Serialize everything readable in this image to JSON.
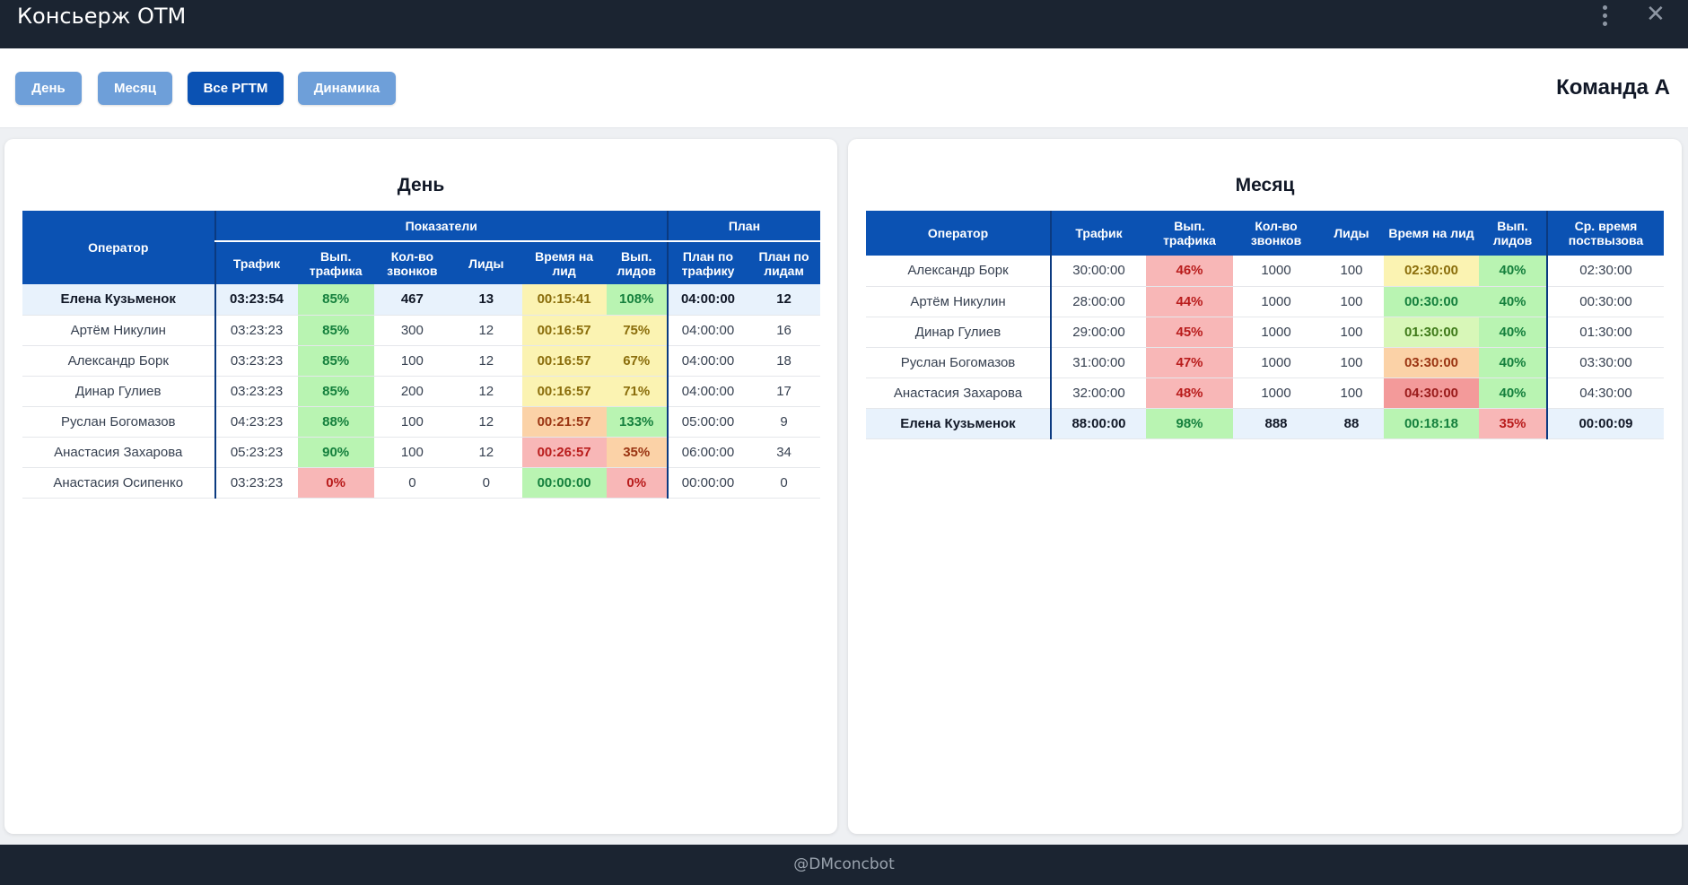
{
  "app": {
    "title": "Консьерж ОТМ"
  },
  "toolbar": {
    "buttons": [
      {
        "label": "День"
      },
      {
        "label": "Месяц"
      },
      {
        "label": "Все РГТМ"
      },
      {
        "label": "Динамика"
      }
    ],
    "team": "Команда А"
  },
  "day": {
    "title": "День",
    "headers": {
      "operator": "Оператор",
      "group_indicators": "Показатели",
      "group_plan": "План",
      "traffic": "Трафик",
      "traffic_pct": "Вып. трафика",
      "calls": "Кол-во звонков",
      "leads": "Лиды",
      "time_per_lead": "Время на лид",
      "leads_pct": "Вып. лидов",
      "plan_traffic": "План по трафику",
      "plan_leads": "План по лидам"
    },
    "rows": [
      [
        "Елена Кузьменок",
        "03:23:54",
        "85%",
        "467",
        "13",
        "00:15:41",
        "108%",
        "04:00:00",
        "12"
      ],
      [
        "Артём Никулин",
        "03:23:23",
        "85%",
        "300",
        "12",
        "00:16:57",
        "75%",
        "04:00:00",
        "16"
      ],
      [
        "Александр Борк",
        "03:23:23",
        "85%",
        "100",
        "12",
        "00:16:57",
        "67%",
        "04:00:00",
        "18"
      ],
      [
        "Динар Гулиев",
        "03:23:23",
        "85%",
        "200",
        "12",
        "00:16:57",
        "71%",
        "04:00:00",
        "17"
      ],
      [
        "Руслан Богомазов",
        "04:23:23",
        "88%",
        "100",
        "12",
        "00:21:57",
        "133%",
        "05:00:00",
        "9"
      ],
      [
        "Анастасия Захарова",
        "05:23:23",
        "90%",
        "100",
        "12",
        "00:26:57",
        "35%",
        "06:00:00",
        "34"
      ],
      [
        "Анастасия Осипенко",
        "03:23:23",
        "0%",
        "0",
        "0",
        "00:00:00",
        "0%",
        "00:00:00",
        "0"
      ]
    ],
    "cell_colors": [
      [
        "",
        "",
        "green",
        "",
        "",
        "yellow",
        "green",
        "",
        ""
      ],
      [
        "",
        "",
        "green",
        "",
        "",
        "yellow",
        "yellow",
        "",
        ""
      ],
      [
        "",
        "",
        "green",
        "",
        "",
        "yellow",
        "yellow",
        "",
        ""
      ],
      [
        "",
        "",
        "green",
        "",
        "",
        "yellow",
        "yellow",
        "",
        ""
      ],
      [
        "",
        "",
        "green",
        "",
        "",
        "orange",
        "green",
        "",
        ""
      ],
      [
        "",
        "",
        "green",
        "",
        "",
        "red",
        "orange",
        "",
        ""
      ],
      [
        "",
        "",
        "red",
        "",
        "",
        "green",
        "red",
        "",
        ""
      ]
    ],
    "highlight_row": 0
  },
  "month": {
    "title": "Месяц",
    "headers": {
      "operator": "Оператор",
      "traffic": "Трафик",
      "traffic_pct": "Вып. трафика",
      "calls": "Кол-во звонков",
      "leads": "Лиды",
      "time_per_lead": "Время на лид",
      "leads_pct": "Вып. лидов",
      "avg_recall": "Ср. время поствызова"
    },
    "rows": [
      [
        "Александр Борк",
        "30:00:00",
        "46%",
        "1000",
        "100",
        "02:30:00",
        "40%",
        "02:30:00"
      ],
      [
        "Артём Никулин",
        "28:00:00",
        "44%",
        "1000",
        "100",
        "00:30:00",
        "40%",
        "00:30:00"
      ],
      [
        "Динар Гулиев",
        "29:00:00",
        "45%",
        "1000",
        "100",
        "01:30:00",
        "40%",
        "01:30:00"
      ],
      [
        "Руслан Богомазов",
        "31:00:00",
        "47%",
        "1000",
        "100",
        "03:30:00",
        "40%",
        "03:30:00"
      ],
      [
        "Анастасия Захарова",
        "32:00:00",
        "48%",
        "1000",
        "100",
        "04:30:00",
        "40%",
        "04:30:00"
      ],
      [
        "Елена Кузьменок",
        "88:00:00",
        "98%",
        "888",
        "88",
        "00:18:18",
        "35%",
        "00:00:09"
      ]
    ],
    "cell_colors": [
      [
        "",
        "",
        "red",
        "",
        "",
        "yellow",
        "green",
        ""
      ],
      [
        "",
        "",
        "red",
        "",
        "",
        "green",
        "green",
        ""
      ],
      [
        "",
        "",
        "red",
        "",
        "",
        "lgreen",
        "green",
        ""
      ],
      [
        "",
        "",
        "red",
        "",
        "",
        "orange",
        "green",
        ""
      ],
      [
        "",
        "",
        "red",
        "",
        "",
        "red2",
        "green",
        ""
      ],
      [
        "",
        "",
        "green",
        "",
        "",
        "green",
        "red",
        ""
      ]
    ],
    "highlight_row": 5
  },
  "footer": {
    "text": "@DMconcbot"
  }
}
